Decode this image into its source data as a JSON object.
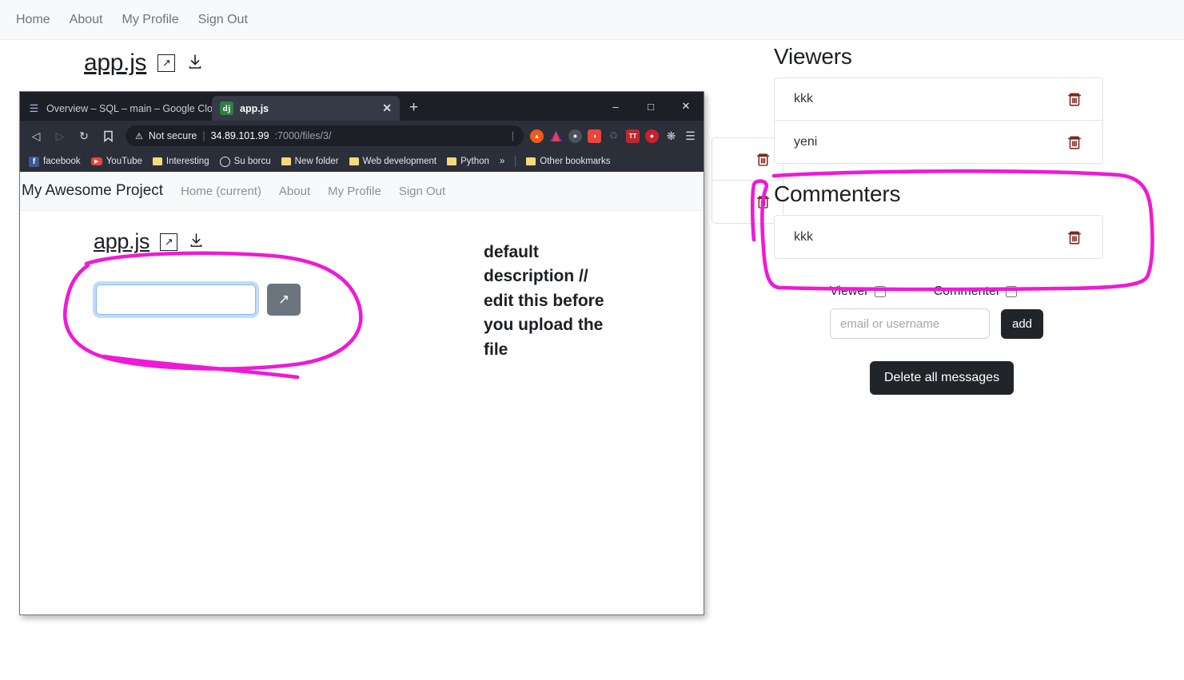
{
  "outer_nav": {
    "items": [
      {
        "label": "Home"
      },
      {
        "label": "About"
      },
      {
        "label": "My Profile"
      },
      {
        "label": "Sign Out"
      }
    ]
  },
  "outer_file": {
    "name": "app.js",
    "open_icon": "external-link-icon",
    "download_icon": "download-icon"
  },
  "viewers": {
    "title": "Viewers",
    "items": [
      {
        "name": "kkk",
        "delete_icon": "trash-icon"
      },
      {
        "name": "yeni",
        "delete_icon": "trash-icon"
      }
    ]
  },
  "commenters": {
    "title": "Commenters",
    "items": [
      {
        "name": "kkk",
        "delete_icon": "trash-icon"
      }
    ]
  },
  "permissions": {
    "viewer_label": "Viewer",
    "commenter_label": "Commenter",
    "viewer_checked": false,
    "commenter_checked": false
  },
  "add_form": {
    "placeholder": "email or username",
    "value": "",
    "button_label": "add"
  },
  "delete_all": {
    "label": "Delete all messages"
  },
  "browser": {
    "tabs": [
      {
        "title": "Overview – SQL – main – Google Cloud",
        "favicon": "google-cloud-icon",
        "active": false
      },
      {
        "title": "app.js",
        "favicon": "django-icon",
        "active": true
      }
    ],
    "new_tab_label": "+",
    "window_controls": {
      "minimize": "–",
      "maximize": "□",
      "close": "✕"
    },
    "toolbar": {
      "back": "◁",
      "forward": "▷",
      "reload": "↻",
      "bookmark": "☐",
      "security_label": "Not secure",
      "url_host": "34.89.101.99",
      "url_path": ":7000/files/3/",
      "menu": "☰"
    },
    "extensions": [
      {
        "name": "brave-icon",
        "color": "#f1581b",
        "glyph": "🦁"
      },
      {
        "name": "triangle-icon",
        "color": "#7b2fbe",
        "glyph": "▲"
      },
      {
        "name": "avatar-icon",
        "color": "#5d626e",
        "glyph": "●"
      },
      {
        "name": "rss-icon",
        "color": "#e8453c",
        "glyph": "◔"
      },
      {
        "name": "recycle-icon",
        "color": "#4a5060",
        "glyph": "♻"
      },
      {
        "name": "tt-icon",
        "color": "#c0272d",
        "glyph": "TT"
      },
      {
        "name": "ladybug-icon",
        "color": "#cc1f2a",
        "glyph": "●"
      },
      {
        "name": "puzzle-icon",
        "color": "#c9ccd1",
        "glyph": "🧩"
      }
    ],
    "bookmarks": [
      {
        "label": "facebook",
        "icon": "facebook-icon"
      },
      {
        "label": "YouTube",
        "icon": "youtube-icon"
      },
      {
        "label": "Interesting",
        "icon": "folder-icon"
      },
      {
        "label": "Su borcu",
        "icon": "globe-icon"
      },
      {
        "label": "New folder",
        "icon": "folder-icon"
      },
      {
        "label": "Web development",
        "icon": "folder-icon"
      },
      {
        "label": "Python",
        "icon": "folder-icon"
      },
      {
        "label": "»",
        "icon": "overflow-icon"
      },
      {
        "label": "Other bookmarks",
        "icon": "folder-icon"
      }
    ],
    "page": {
      "brand": "My Awesome Project",
      "nav": [
        {
          "label": "Home (current)"
        },
        {
          "label": "About"
        },
        {
          "label": "My Profile"
        },
        {
          "label": "Sign Out"
        }
      ],
      "file_name": "app.js",
      "open_icon": "external-link-icon",
      "download_icon": "download-icon",
      "rename_input": {
        "value": "",
        "placeholder": ""
      },
      "submit_icon": "arrow-up-right-icon",
      "description": "default description // edit this before you upload the file"
    }
  },
  "annotation": {
    "color": "#ef19d8",
    "shapes": [
      "circle-around-rename-input",
      "rounded-rect-around-commenters"
    ]
  }
}
